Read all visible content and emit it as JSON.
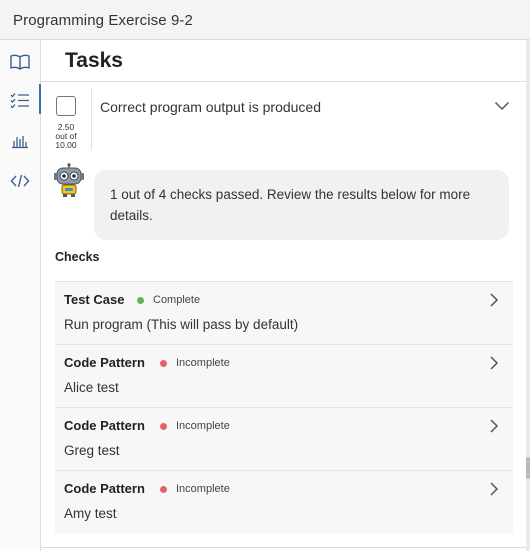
{
  "window": {
    "title": "Programming Exercise 9-2"
  },
  "sidebar": {
    "items": [
      {
        "icon": "book-icon"
      },
      {
        "icon": "task-list-icon",
        "active": true
      },
      {
        "icon": "bar-chart-icon"
      },
      {
        "icon": "code-icon"
      }
    ]
  },
  "main": {
    "heading": "Tasks",
    "task": {
      "title": "Correct program output is produced",
      "score": "2.50",
      "score_of": "out of",
      "score_total": "10.00"
    },
    "feedback": "1 out of 4 checks passed. Review the results below for more details.",
    "checks_heading": "Checks",
    "checks": [
      {
        "title": "Test Case",
        "status": "Complete",
        "status_color": "#5cb85c",
        "description": "Run program (This will pass by default)"
      },
      {
        "title": "Code Pattern",
        "status": "Incomplete",
        "status_color": "#e06666",
        "description": "Alice test"
      },
      {
        "title": "Code Pattern",
        "status": "Incomplete",
        "status_color": "#e06666",
        "description": "Greg test"
      },
      {
        "title": "Code Pattern",
        "status": "Incomplete",
        "status_color": "#e06666",
        "description": "Amy test"
      }
    ]
  },
  "colors": {
    "accent": "#3a6fb0",
    "complete": "#5cb85c",
    "incomplete": "#e06666"
  }
}
